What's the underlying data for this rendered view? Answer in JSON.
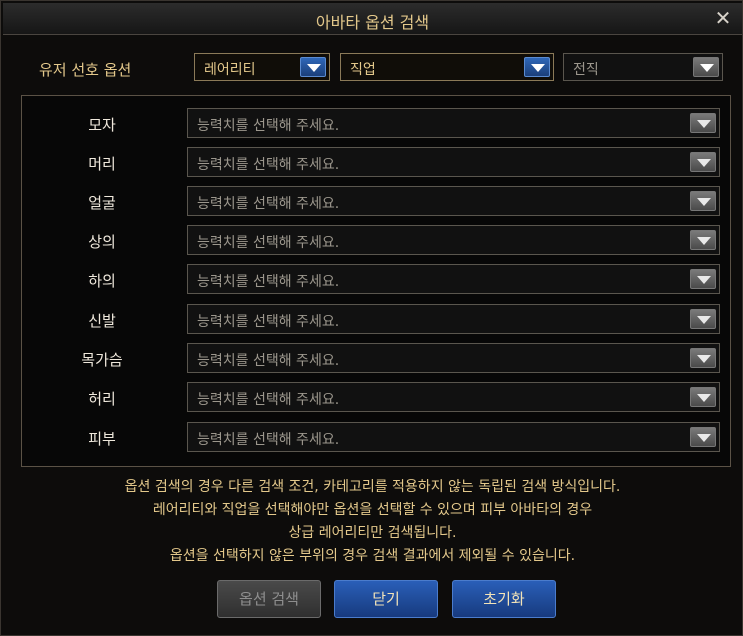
{
  "window": {
    "title": "아바타 옵션 검색",
    "close_symbol": "✕"
  },
  "preferences": {
    "label": "유저 선호 옵션",
    "selects": [
      {
        "value": "레어리티"
      },
      {
        "value": "직업"
      },
      {
        "value": "전직"
      }
    ]
  },
  "slots": [
    {
      "label": "모자",
      "value": "능력치를 선택해 주세요."
    },
    {
      "label": "머리",
      "value": "능력치를 선택해 주세요."
    },
    {
      "label": "얼굴",
      "value": "능력치를 선택해 주세요."
    },
    {
      "label": "상의",
      "value": "능력치를 선택해 주세요."
    },
    {
      "label": "하의",
      "value": "능력치를 선택해 주세요."
    },
    {
      "label": "신발",
      "value": "능력치를 선택해 주세요."
    },
    {
      "label": "목가슴",
      "value": "능력치를 선택해 주세요."
    },
    {
      "label": "허리",
      "value": "능력치를 선택해 주세요."
    },
    {
      "label": "피부",
      "value": "능력치를 선택해 주세요."
    }
  ],
  "notice": [
    "옵션 검색의 경우 다른 검색 조건, 카테고리를 적용하지 않는 독립된 검색 방식입니다.",
    "레어리티와 직업을 선택해야만 옵션을 선택할 수 있으며 피부 아바타의 경우",
    "상급 레어리티만 검색됩니다.",
    "옵션을 선택하지 않은 부위의 경우 검색 결과에서 제외될 수 있습니다."
  ],
  "buttons": {
    "search": "옵션 검색",
    "close": "닫기",
    "reset": "초기화"
  },
  "colors": {
    "accent_gold": "#e3c88b",
    "button_blue": "#2a5fb8"
  }
}
